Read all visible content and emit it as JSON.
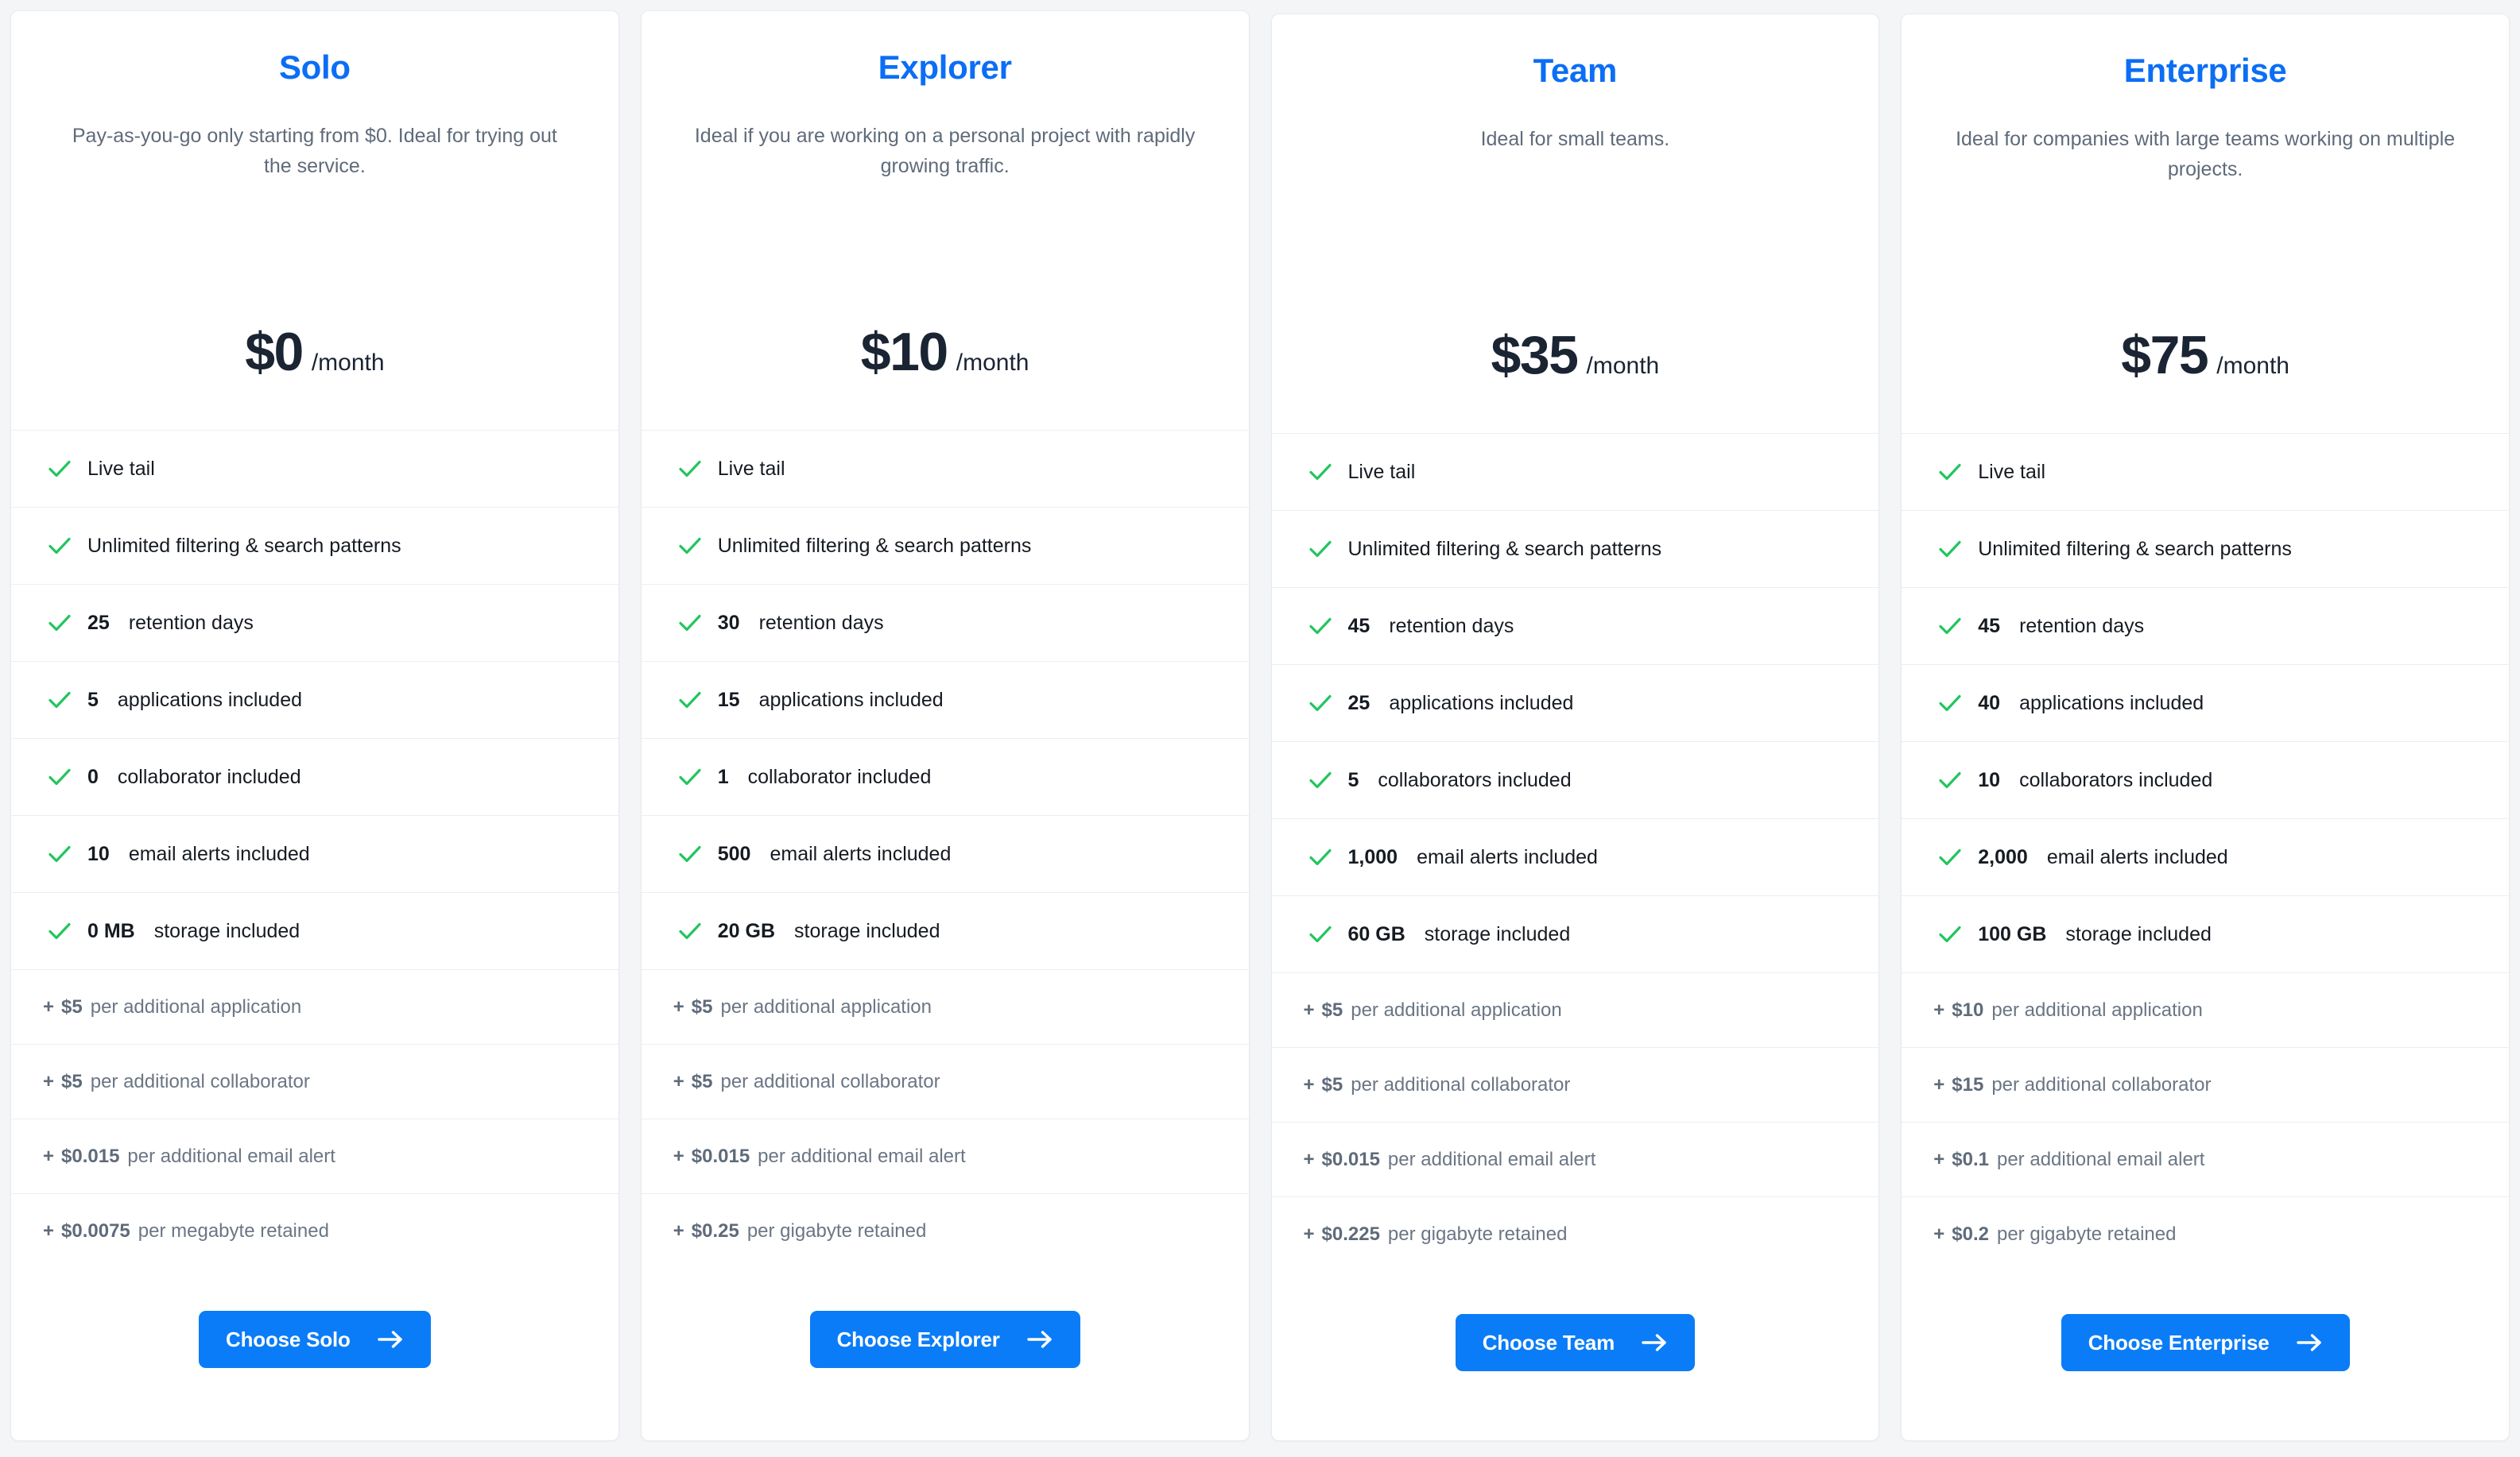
{
  "theme": {
    "page_background": "#f4f5f7",
    "card_background": "#ffffff",
    "accent_blue": "#0b6ef5",
    "button_blue": "#0b7cf7",
    "check_green": "#22c55e",
    "price_color": "#1b2433",
    "muted_text": "#5f6b7a"
  },
  "icons": {
    "check": "check-icon",
    "arrow_right": "arrow-right-icon"
  },
  "plans": [
    {
      "name": "Solo",
      "description": "Pay-as-you-go only starting from $0. Ideal for trying out the service.",
      "price": "$0",
      "period": "/month",
      "features": [
        {
          "value": "",
          "label": "Live tail"
        },
        {
          "value": "",
          "label": "Unlimited filtering & search patterns"
        },
        {
          "value": "25",
          "label": "retention days"
        },
        {
          "value": "5",
          "label": "applications included"
        },
        {
          "value": "0",
          "label": "collaborator included"
        },
        {
          "value": "10",
          "label": "email alerts included"
        },
        {
          "value": "0 MB",
          "label": "storage included"
        }
      ],
      "extras": [
        {
          "plus": "+",
          "value": "$5",
          "label": "per additional application"
        },
        {
          "plus": "+",
          "value": "$5",
          "label": "per additional collaborator"
        },
        {
          "plus": "+",
          "value": "$0.015",
          "label": "per additional email alert"
        },
        {
          "plus": "+",
          "value": "$0.0075",
          "label": "per megabyte retained"
        }
      ],
      "cta_label": "Choose Solo"
    },
    {
      "name": "Explorer",
      "description": "Ideal if you are working on a personal project with rapidly growing traffic.",
      "price": "$10",
      "period": "/month",
      "features": [
        {
          "value": "",
          "label": "Live tail"
        },
        {
          "value": "",
          "label": "Unlimited filtering & search patterns"
        },
        {
          "value": "30",
          "label": "retention days"
        },
        {
          "value": "15",
          "label": "applications included"
        },
        {
          "value": "1",
          "label": "collaborator included"
        },
        {
          "value": "500",
          "label": "email alerts included"
        },
        {
          "value": "20 GB",
          "label": "storage included"
        }
      ],
      "extras": [
        {
          "plus": "+",
          "value": "$5",
          "label": "per additional application"
        },
        {
          "plus": "+",
          "value": "$5",
          "label": "per additional collaborator"
        },
        {
          "plus": "+",
          "value": "$0.015",
          "label": "per additional email alert"
        },
        {
          "plus": "+",
          "value": "$0.25",
          "label": "per gigabyte retained"
        }
      ],
      "cta_label": "Choose Explorer"
    },
    {
      "name": "Team",
      "description": "Ideal for small teams.",
      "price": "$35",
      "period": "/month",
      "features": [
        {
          "value": "",
          "label": "Live tail"
        },
        {
          "value": "",
          "label": "Unlimited filtering & search patterns"
        },
        {
          "value": "45",
          "label": "retention days"
        },
        {
          "value": "25",
          "label": "applications included"
        },
        {
          "value": "5",
          "label": "collaborators included"
        },
        {
          "value": "1,000",
          "label": "email alerts included"
        },
        {
          "value": "60 GB",
          "label": "storage included"
        }
      ],
      "extras": [
        {
          "plus": "+",
          "value": "$5",
          "label": "per additional application"
        },
        {
          "plus": "+",
          "value": "$5",
          "label": "per additional collaborator"
        },
        {
          "plus": "+",
          "value": "$0.015",
          "label": "per additional email alert"
        },
        {
          "plus": "+",
          "value": "$0.225",
          "label": "per gigabyte retained"
        }
      ],
      "cta_label": "Choose Team"
    },
    {
      "name": "Enterprise",
      "description": "Ideal for companies with large teams working on multiple projects.",
      "price": "$75",
      "period": "/month",
      "features": [
        {
          "value": "",
          "label": "Live tail"
        },
        {
          "value": "",
          "label": "Unlimited filtering & search patterns"
        },
        {
          "value": "45",
          "label": "retention days"
        },
        {
          "value": "40",
          "label": "applications included"
        },
        {
          "value": "10",
          "label": "collaborators included"
        },
        {
          "value": "2,000",
          "label": "email alerts included"
        },
        {
          "value": "100 GB",
          "label": "storage included"
        }
      ],
      "extras": [
        {
          "plus": "+",
          "value": "$10",
          "label": "per additional application"
        },
        {
          "plus": "+",
          "value": "$15",
          "label": "per additional collaborator"
        },
        {
          "plus": "+",
          "value": "$0.1",
          "label": "per additional email alert"
        },
        {
          "plus": "+",
          "value": "$0.2",
          "label": "per gigabyte retained"
        }
      ],
      "cta_label": "Choose Enterprise"
    }
  ]
}
